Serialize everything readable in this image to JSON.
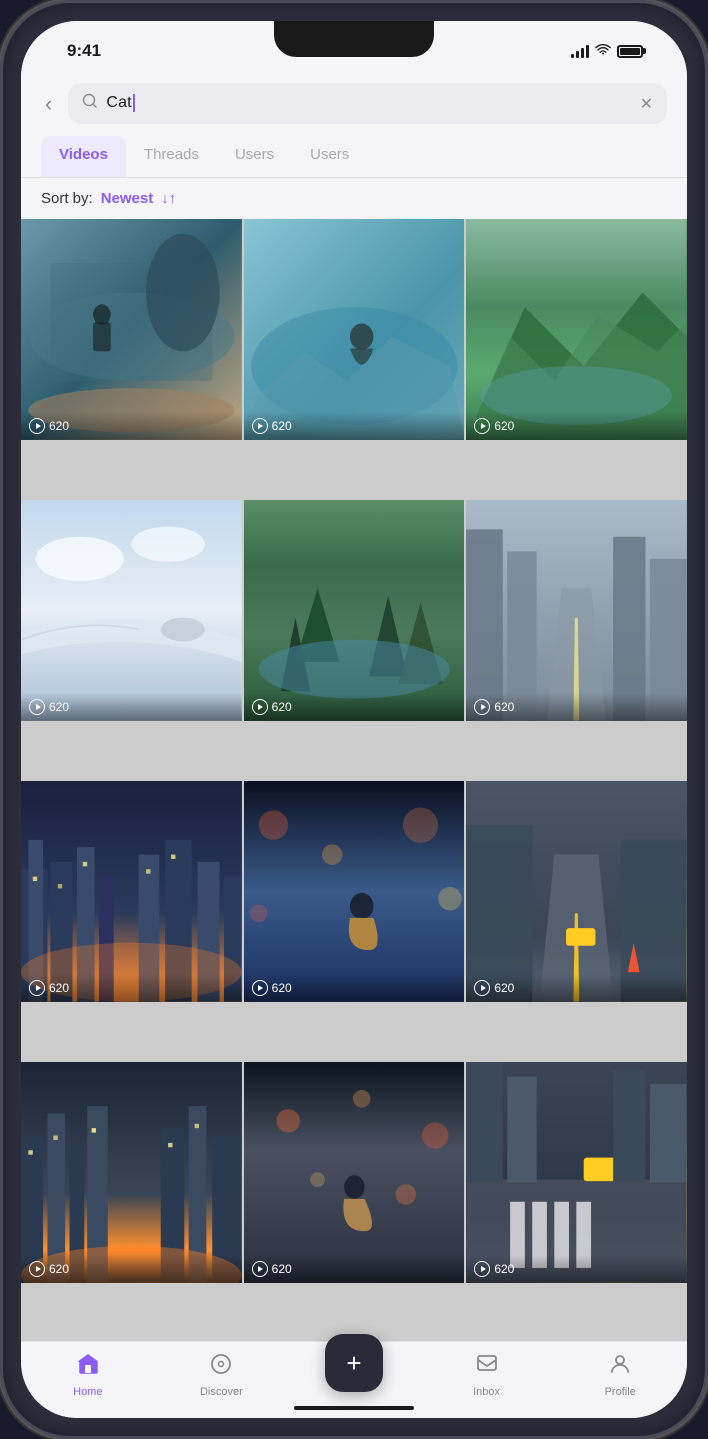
{
  "status": {
    "time": "9:41",
    "signal_bars": [
      4,
      7,
      10,
      13
    ],
    "wifi": "wifi",
    "battery": 100
  },
  "header": {
    "back_label": "‹",
    "search_query": "Cat",
    "clear_label": "✕"
  },
  "tabs": [
    {
      "id": "videos",
      "label": "Videos",
      "active": true
    },
    {
      "id": "threads",
      "label": "Threads",
      "active": false
    },
    {
      "id": "users1",
      "label": "Users",
      "active": false
    },
    {
      "id": "users2",
      "label": "Users",
      "active": false
    }
  ],
  "sort": {
    "label": "Sort by:",
    "value": "Newest",
    "icon": "↓↑"
  },
  "videos": [
    {
      "id": 1,
      "count": "620",
      "thumb_class": "thumb-1"
    },
    {
      "id": 2,
      "count": "620",
      "thumb_class": "thumb-2"
    },
    {
      "id": 3,
      "count": "620",
      "thumb_class": "thumb-3"
    },
    {
      "id": 4,
      "count": "620",
      "thumb_class": "thumb-4"
    },
    {
      "id": 5,
      "count": "620",
      "thumb_class": "thumb-5"
    },
    {
      "id": 6,
      "count": "620",
      "thumb_class": "thumb-6"
    },
    {
      "id": 7,
      "count": "620",
      "thumb_class": "thumb-7"
    },
    {
      "id": 8,
      "count": "620",
      "thumb_class": "thumb-8"
    },
    {
      "id": 9,
      "count": "620",
      "thumb_class": "thumb-9"
    },
    {
      "id": 10,
      "count": "620",
      "thumb_class": "thumb-10"
    },
    {
      "id": 11,
      "count": "620",
      "thumb_class": "thumb-11"
    },
    {
      "id": 12,
      "count": "620",
      "thumb_class": "thumb-12"
    }
  ],
  "nav": {
    "items": [
      {
        "id": "home",
        "label": "Home",
        "active": true
      },
      {
        "id": "discover",
        "label": "Discover",
        "active": false
      },
      {
        "id": "inbox",
        "label": "Inbox",
        "active": false
      },
      {
        "id": "profile",
        "label": "Profile",
        "active": false
      }
    ],
    "fab_label": "+"
  },
  "colors": {
    "accent": "#8b5cf6",
    "active_tab_bg": "#ede9ff"
  }
}
